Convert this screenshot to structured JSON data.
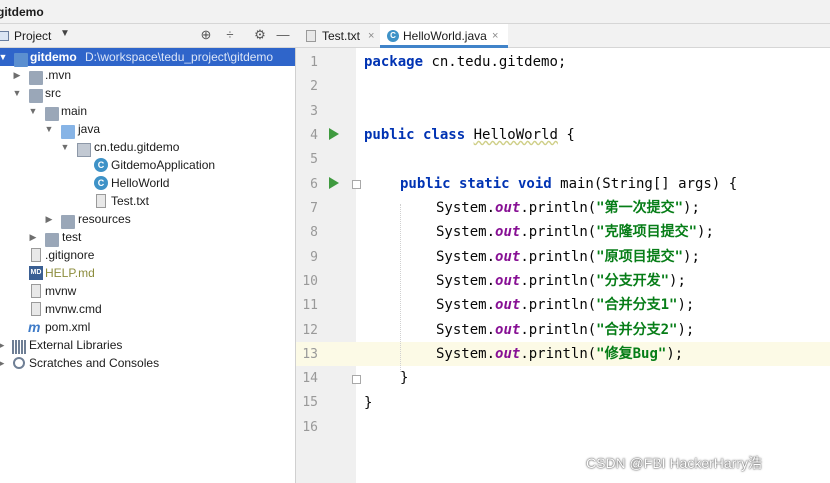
{
  "titlebar": {
    "title": "gitdemo"
  },
  "project_panel": {
    "title": "Project",
    "dropdown_symbol": "▼",
    "actions": {
      "locate": "⊕",
      "collapse": "÷",
      "settings": "⚙",
      "hide": "—"
    }
  },
  "tree": {
    "root": {
      "name": "gitdemo",
      "path": "D:\\workspace\\tedu_project\\gitdemo"
    },
    "mvn": ".mvn",
    "src": "src",
    "main": "main",
    "java": "java",
    "package": "cn.tedu.gitdemo",
    "gitdemo_application": "GitdemoApplication",
    "hello_world": "HelloWorld",
    "test_txt": "Test.txt",
    "resources": "resources",
    "test": "test",
    "gitignore": ".gitignore",
    "help_md": "HELP.md",
    "mvnw": "mvnw",
    "mvnw_cmd": "mvnw.cmd",
    "pom": "pom.xml",
    "external_libraries": "External Libraries",
    "scratches": "Scratches and Consoles"
  },
  "tabs": [
    {
      "label": "Test.txt",
      "close": "×"
    },
    {
      "label": "HelloWorld.java",
      "close": "×"
    }
  ],
  "editor": {
    "line_numbers": [
      "1",
      "2",
      "3",
      "4",
      "5",
      "6",
      "7",
      "8",
      "9",
      "10",
      "11",
      "12",
      "13",
      "14",
      "15",
      "16"
    ],
    "current_line": "13",
    "lines": {
      "l1_kw": "package",
      "l1_rest": " cn.tedu.gitdemo;",
      "l4_kw": "public class",
      "l4_name": "HelloWorld",
      "l4_rest": " {",
      "l6_kw": "public static void",
      "l6_rest": " main(String[] args) {",
      "sys": "System.",
      "out": "out",
      "println": ".println(",
      "end": ");",
      "s7": "\"第一次提交\"",
      "s8": "\"克隆项目提交\"",
      "s9": "\"原项目提交\"",
      "s10": "\"分支开发\"",
      "s11": "\"合并分支1\"",
      "s12": "\"合并分支2\"",
      "s13": "\"修复Bug\"",
      "l14": "}",
      "l15": "}"
    }
  },
  "watermark": "CSDN @FBI HackerHarry浩",
  "colors": {
    "selection": "#2f65ca",
    "keyword": "#0033b3",
    "string": "#067d17",
    "field": "#871094"
  }
}
